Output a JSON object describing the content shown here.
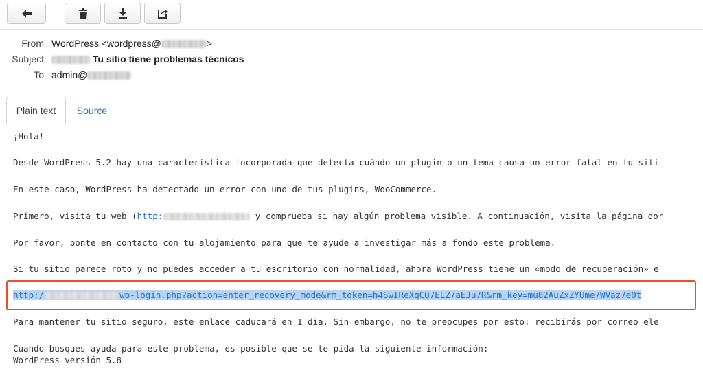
{
  "toolbar": {
    "buttons": [
      {
        "name": "back",
        "icon": "arrow-left-icon"
      },
      {
        "name": "delete",
        "icon": "trash-icon"
      },
      {
        "name": "download",
        "icon": "download-icon"
      },
      {
        "name": "forward",
        "icon": "forward-icon"
      }
    ]
  },
  "header": {
    "from_label": "From",
    "from_value": "WordPress <wordpress@",
    "from_suffix": ">",
    "subject_label": "Subject",
    "subject_value": "Tu sitio tiene problemas técnicos",
    "to_label": "To",
    "to_value": "admin@"
  },
  "tabs": {
    "plain_text": "Plain text",
    "source": "Source"
  },
  "body": {
    "l1": "¡Hola!",
    "l2": "Desde WordPress 5.2 hay una característica incorporada que detecta cuándo un plugin o un tema causa un error fatal en tu siti",
    "l3": "En este caso, WordPress ha detectado un error con uno de tus plugins, WooCommerce.",
    "l4a": "Primero, visita tu web (",
    "l4link": "http:",
    "l4b": " y comprueba si hay algún problema visible. A continuación, visita la página dor",
    "l5": "Por favor, ponte en contacto con tu alojamiento para que te ayude a investigar más a fondo este problema.",
    "l6": "Si tu sitio parece roto y no puedes acceder a tu escritorio con normalidad, ahora WordPress tiene un «modo de recuperación» e",
    "link_prefix": "http:/",
    "link_rest": "wp-login.php?action=enter_recovery_mode&rm_token=h4SwIReXqCQ7ELZ7aEJu7R&rm_key=mu82AuZxZYUme7WVaz7e0t",
    "l8": "Para mantener tu sitio seguro, este enlace caducará en 1 día. Sin embargo, no te preocupes por esto: recibirás por correo ele",
    "l9": "Cuando busques ayuda para este problema, es posible que se te pida la siguiente información:",
    "l10": "WordPress versión 5.8"
  },
  "colors": {
    "highlight_box": "#e8502a",
    "selection": "#b5d4f6",
    "link": "#2a6db5"
  }
}
